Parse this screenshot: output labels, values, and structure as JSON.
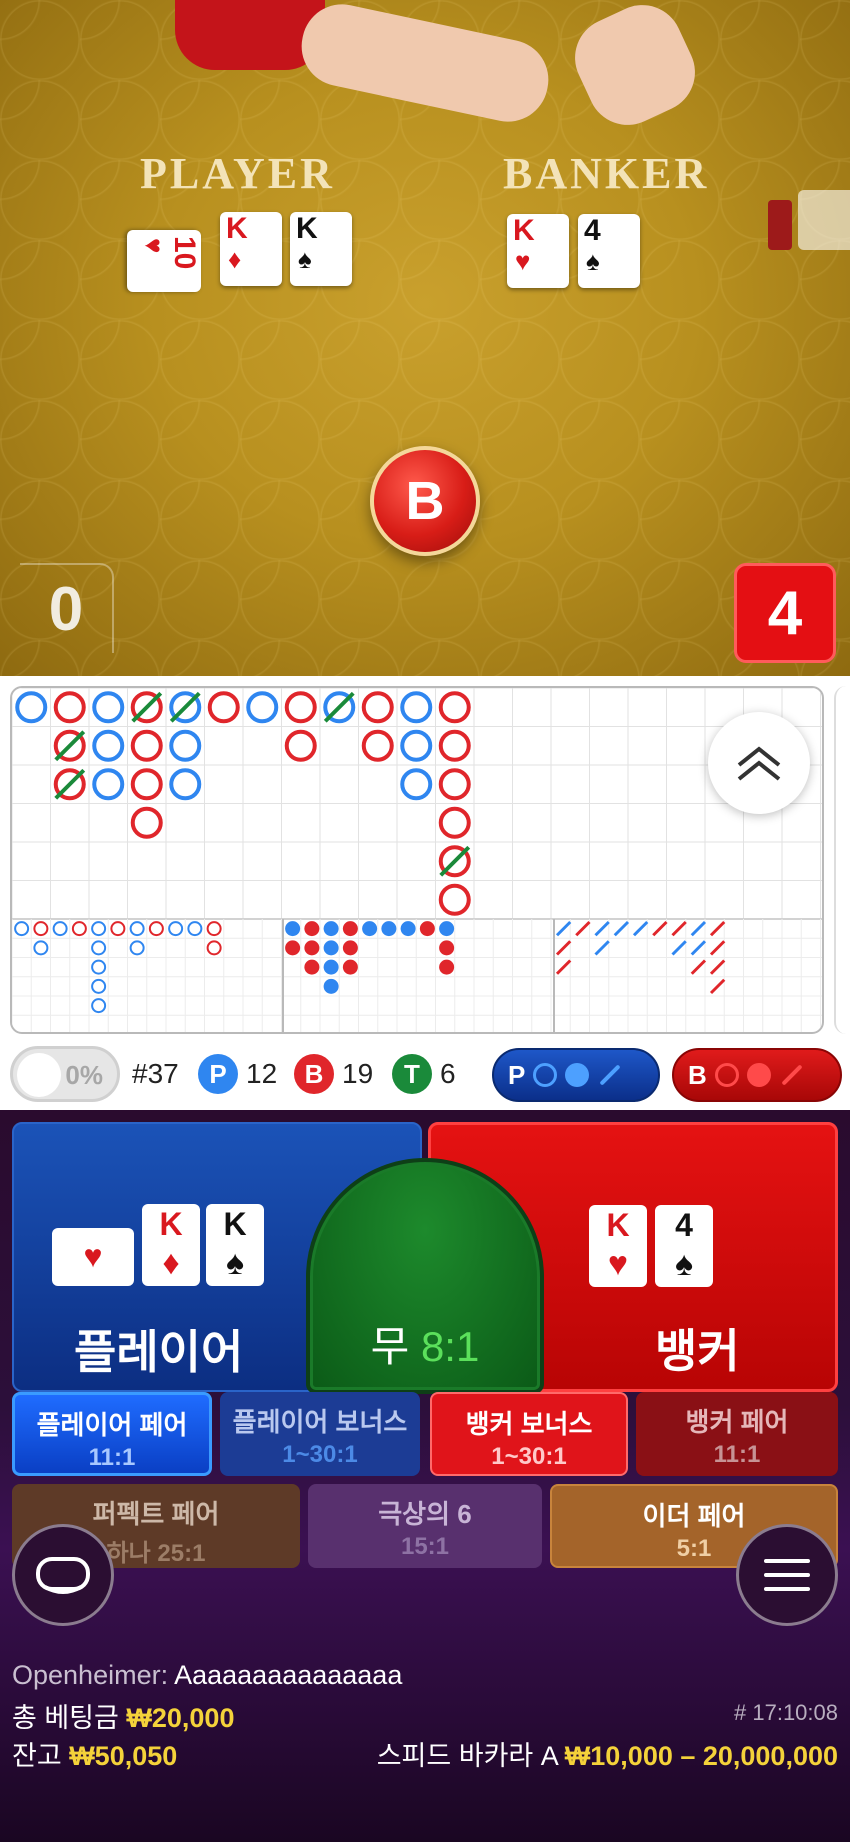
{
  "table": {
    "player_label": "PLAYER",
    "banker_label": "BANKER",
    "player_cards": [
      {
        "rank": "10",
        "suit": "♥",
        "color": "red"
      },
      {
        "rank": "K",
        "suit": "♦",
        "color": "red"
      },
      {
        "rank": "K",
        "suit": "♠",
        "color": "black"
      }
    ],
    "banker_cards": [
      {
        "rank": "K",
        "suit": "♥",
        "color": "red"
      },
      {
        "rank": "4",
        "suit": "♠",
        "color": "black"
      }
    ],
    "winner_marker": "B",
    "player_score": "0",
    "banker_score": "4"
  },
  "roadmap": {
    "colors": {
      "player": "#2f86f0",
      "banker": "#e0262b",
      "tie": "#1a8a3a"
    },
    "collapse_icon": "chevron-double-up-icon"
  },
  "stats": {
    "percent_toggle": "0%",
    "round": "#37",
    "player_letter": "P",
    "player_count": "12",
    "banker_letter": "B",
    "banker_count": "19",
    "tie_letter": "T",
    "tie_count": "6",
    "predict_player": "P",
    "predict_banker": "B"
  },
  "bets": {
    "player_label": "플레이어",
    "tie_label": "무",
    "tie_odds": "8:1",
    "banker_label": "뱅커",
    "side_bets": [
      {
        "title": "플레이어 페어",
        "odds": "11:1"
      },
      {
        "title": "플레이어 보너스",
        "odds": "1~30:1"
      },
      {
        "title": "뱅커 보너스",
        "odds": "1~30:1"
      },
      {
        "title": "뱅커 페어",
        "odds": "11:1"
      },
      {
        "title": "퍼펙트 페어",
        "odds": "하나 25:1"
      },
      {
        "title": "극상의 6",
        "odds": "15:1"
      },
      {
        "title": "이더 페어",
        "odds": "5:1"
      }
    ]
  },
  "info": {
    "movie_label": "Openheimer:",
    "username": "Aaaaaaaaaaaaaaa",
    "total_bet_label": "총 베팅금",
    "total_bet_value": "₩20,000",
    "game_id": "# 17:10:08",
    "balance_label": "잔고",
    "balance_value": "₩50,050",
    "table_name": "스피드 바카라 A",
    "limits": "₩10,000 – 20,000,000"
  }
}
